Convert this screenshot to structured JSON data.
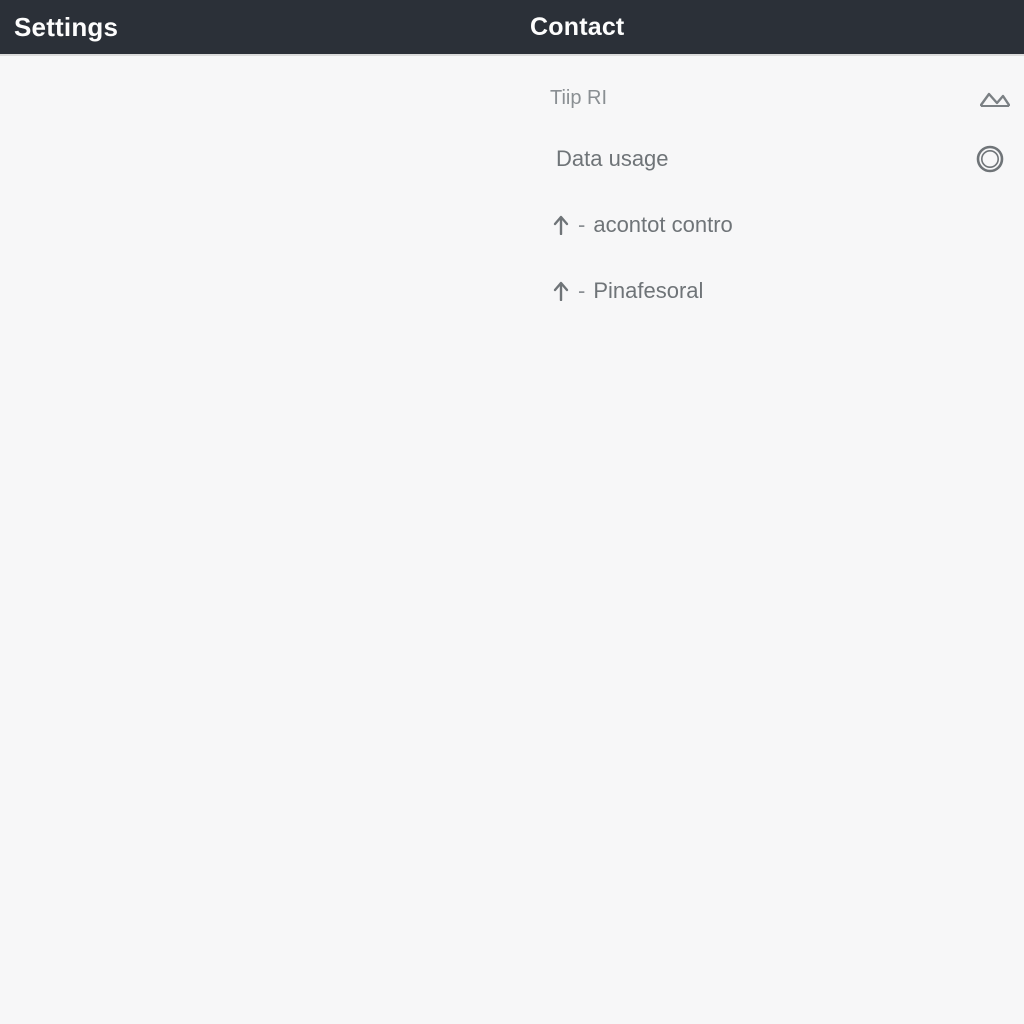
{
  "header": {
    "left_title": "Settings",
    "center_title": "Contact"
  },
  "panel": {
    "section_label": "Tiip RI",
    "rows": [
      {
        "label": "Data usage",
        "icon": "ring"
      },
      {
        "prefix": "-",
        "label": "acontot contro"
      },
      {
        "prefix": "-",
        "label": "Pinafesoral"
      }
    ]
  }
}
